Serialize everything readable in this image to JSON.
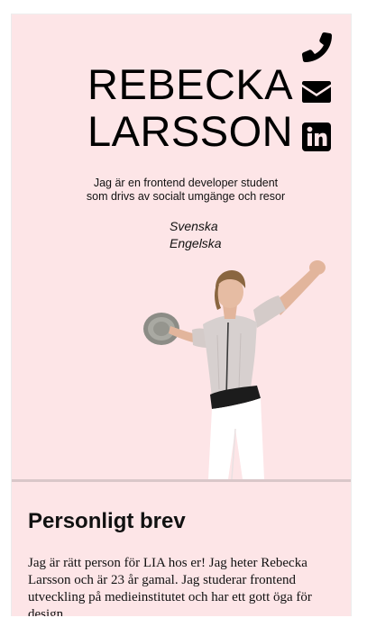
{
  "header": {
    "name_line1": "REBECKA",
    "name_line2": "LARSSON",
    "tagline_line1": "Jag är en frontend developer student",
    "tagline_line2": "som drivs av socialt umgänge och resor",
    "languages": [
      "Svenska",
      "Engelska"
    ]
  },
  "contact_icons": [
    "phone-icon",
    "envelope-icon",
    "linkedin-icon"
  ],
  "letter": {
    "title": "Personligt brev",
    "body": "Jag är rätt person för LIA hos er! Jag heter Rebecka Larsson och är 23 år gamal. Jag studerar frontend utveckling på medieinstitutet och har ett gott öga för design."
  },
  "colors": {
    "background": "#fde5e7",
    "text": "#000000",
    "divider": "#d9c7c9"
  }
}
